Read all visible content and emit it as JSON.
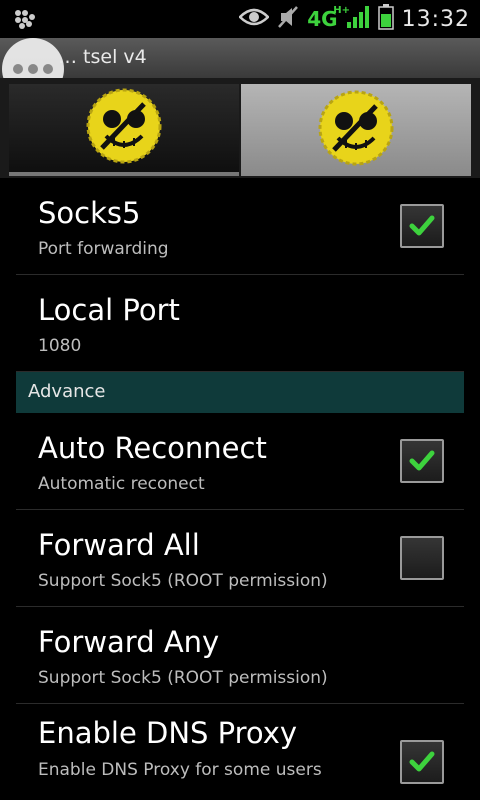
{
  "status_bar": {
    "network": "4G",
    "network_sub": "H+",
    "time": "13:32"
  },
  "app": {
    "title": "… tsel v4"
  },
  "settings": {
    "socks5": {
      "title": "Socks5",
      "subtitle": "Port forwarding",
      "checked": true
    },
    "local_port": {
      "title": "Local Port",
      "subtitle": "1080"
    },
    "section_advance": "Advance",
    "auto_reconnect": {
      "title": "Auto Reconnect",
      "subtitle": "Automatic reconect",
      "checked": true
    },
    "forward_all": {
      "title": "Forward All",
      "subtitle": "Support Sock5 (ROOT permission)",
      "checked": false
    },
    "forward_any": {
      "title": "Forward Any",
      "subtitle": "Support Sock5 (ROOT permission)"
    },
    "enable_dns": {
      "title": "Enable DNS Proxy",
      "subtitle": "Enable DNS Proxy for some users",
      "checked": true
    }
  },
  "icons": {
    "status_left": "bbm-icon",
    "status_eye": "eye-icon",
    "status_mute": "mute-icon",
    "status_signal": "signal-icon",
    "status_battery": "battery-icon",
    "tab_logo": "pirate-skull-icon",
    "overflow": "more-dots-icon",
    "checkmark": "check-icon"
  },
  "colors": {
    "accent_green": "#3dd23d",
    "section_bg": "#0f3a3a",
    "skull_yellow": "#e8d41a"
  }
}
